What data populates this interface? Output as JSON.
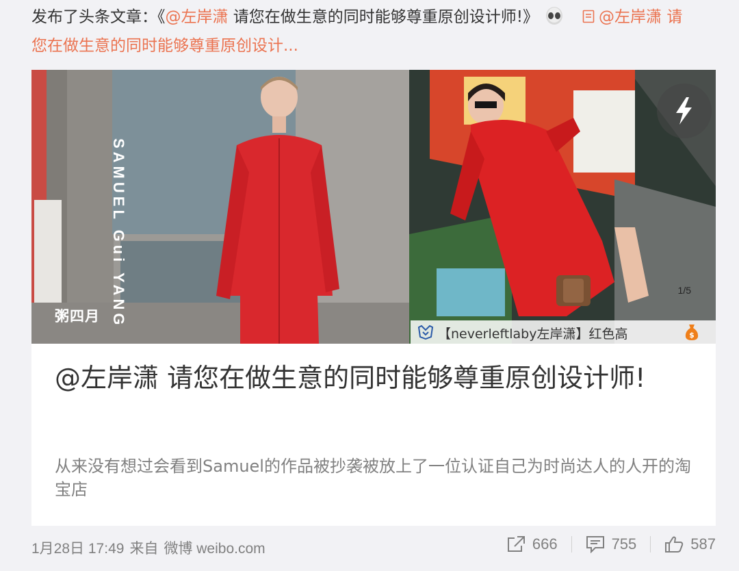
{
  "post": {
    "prefix": "发布了头条文章：《",
    "mention": "@左岸潇",
    "title_text": " 请您在做生意的同时能够尊重原创设计师!》",
    "link_line1": "@左岸潇 请",
    "link_line2": "您在做生意的同时能够尊重原创设计..."
  },
  "images": {
    "left_caption": "粥四月",
    "left_vertical": "SAMUEL Gui YANG",
    "page_indicator": "1/5",
    "right_footer_text": "【neverleftlaby左岸潇】红色高",
    "flash_icon": "flash-icon",
    "shop_icon": "shop-badge-icon",
    "bag_icon": "money-bag-icon"
  },
  "article": {
    "title": "@左岸潇 请您在做生意的同时能够尊重原创设计师!",
    "summary": "从来没有想过会看到Samuel的作品被抄袭被放上了一位认证自己为时尚达人的人开的淘宝店"
  },
  "meta": {
    "date": "1月28日 17:49",
    "from": "来自",
    "source": "微博 weibo.com"
  },
  "actions": {
    "share": "666",
    "comment": "755",
    "like": "587"
  },
  "colors": {
    "accent": "#eb7350",
    "text": "#333333",
    "muted": "#808080",
    "background": "#f2f2f5"
  }
}
